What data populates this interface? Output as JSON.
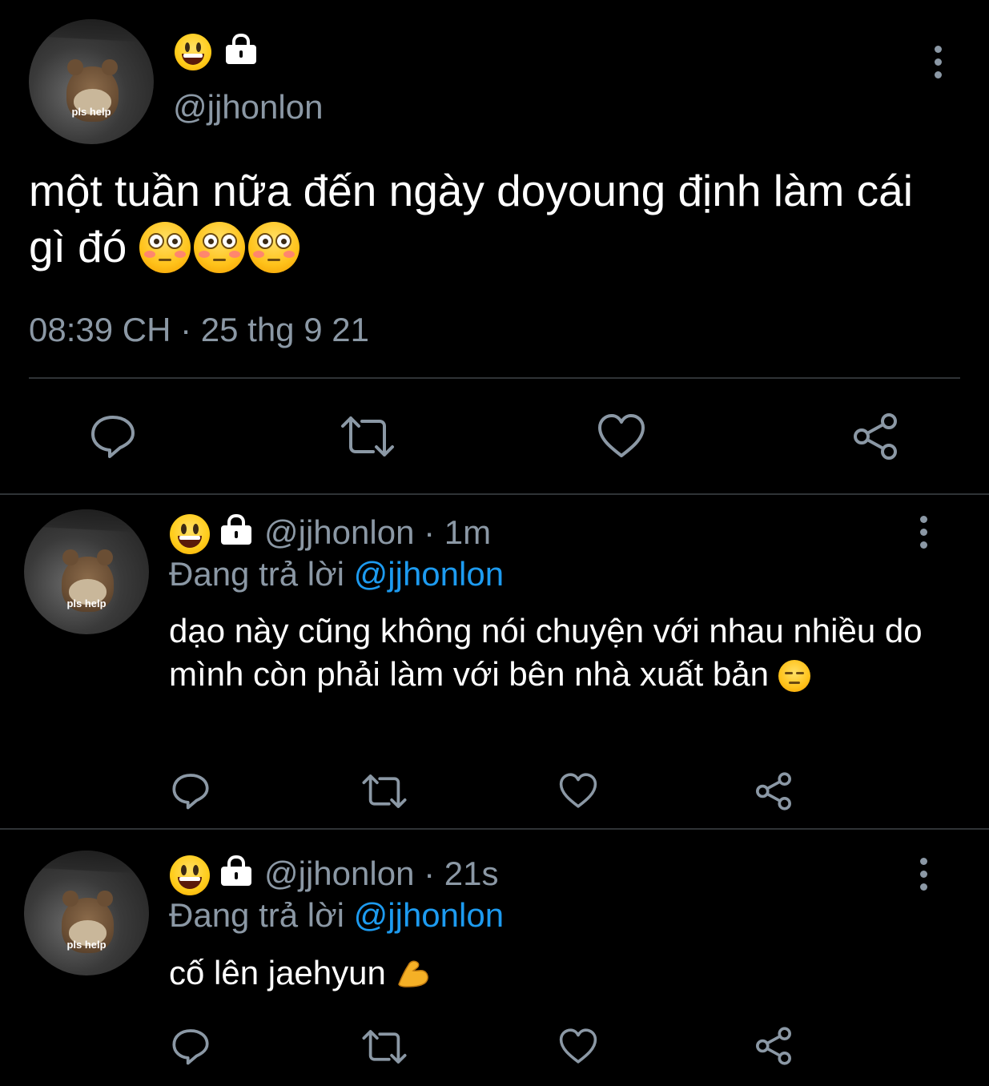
{
  "colors": {
    "background": "#000000",
    "text_primary": "#ffffff",
    "text_secondary": "#8b98a5",
    "link": "#1d9bf0",
    "divider": "#2f3336"
  },
  "main_tweet": {
    "avatar_caption": "pls help",
    "display_name_icons": [
      "grinning-face-emoji",
      "lock-icon"
    ],
    "handle": "@jjhonlon",
    "text": "một tuần nữa đến ngày doyoung định làm cái gì đó",
    "trailing_emojis": [
      "flushed-face-emoji",
      "flushed-face-emoji",
      "flushed-face-emoji"
    ],
    "timestamp": "08:39 CH · 25 thg 9 21",
    "actions": [
      "reply-icon",
      "retweet-icon",
      "like-icon",
      "share-icon"
    ]
  },
  "replies": [
    {
      "avatar_caption": "pls help",
      "handle_time": "@jjhonlon · 1m",
      "replying_prefix": "Đang trả lời",
      "replying_to": "@jjhonlon",
      "text": "dạo này cũng không nói chuyện với nhau nhiều do mình còn phải làm với bên nhà xuất bản",
      "trailing_emoji": "pensive-face-emoji"
    },
    {
      "avatar_caption": "pls help",
      "handle_time": "@jjhonlon · 21s",
      "replying_prefix": "Đang trả lời",
      "replying_to": "@jjhonlon",
      "text": "cố lên jaehyun",
      "trailing_emoji": "flexed-biceps-emoji"
    }
  ]
}
